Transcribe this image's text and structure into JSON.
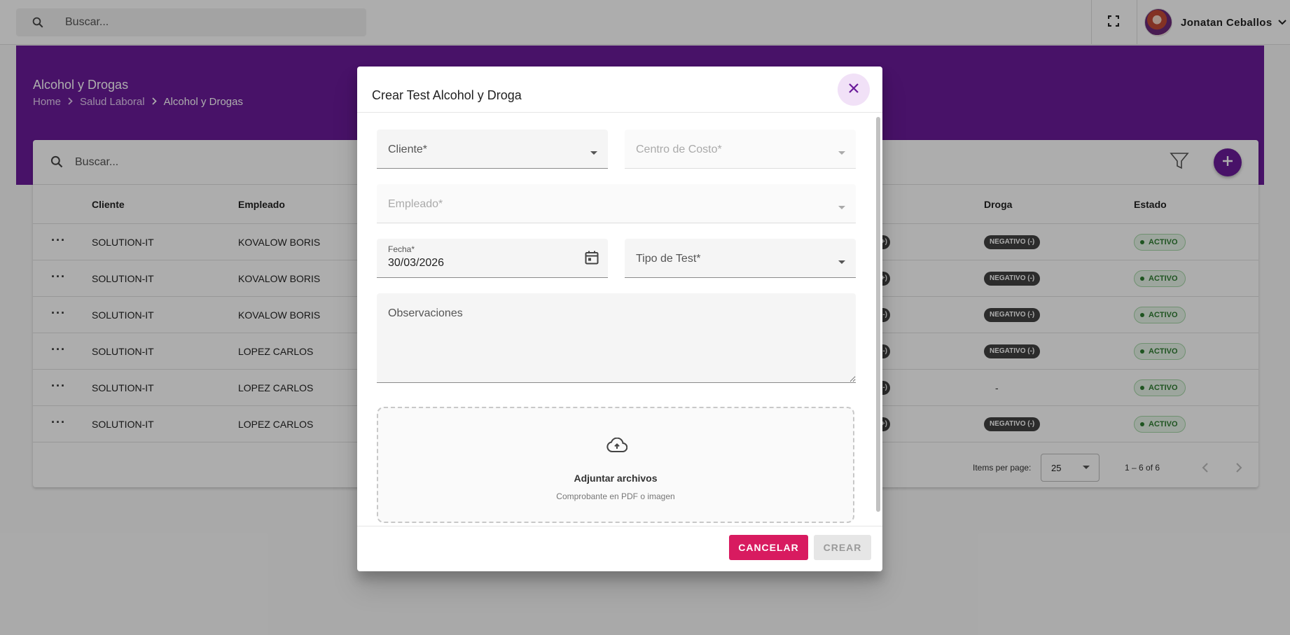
{
  "topbar": {
    "search_placeholder": "Buscar...",
    "user_name": "Jonatan Ceballos"
  },
  "header": {
    "title": "Alcohol y Drogas",
    "breadcrumb": [
      "Home",
      "Salud Laboral",
      "Alcohol y Drogas"
    ]
  },
  "table": {
    "search_placeholder": "Buscar...",
    "columns": [
      "Cliente",
      "Empleado",
      "Droga",
      "Estado"
    ],
    "rows": [
      {
        "cliente": "SOLUTION-IT",
        "empleado": "KOVALOW BORIS",
        "alcohol_chip": "+)",
        "droga": "NEGATIVO (-)",
        "estado": "ACTIVO"
      },
      {
        "cliente": "SOLUTION-IT",
        "empleado": "KOVALOW BORIS",
        "alcohol_chip": "+)",
        "droga": "NEGATIVO (-)",
        "estado": "ACTIVO"
      },
      {
        "cliente": "SOLUTION-IT",
        "empleado": "KOVALOW BORIS",
        "alcohol_chip": "-)",
        "droga": "NEGATIVO (-)",
        "estado": "ACTIVO"
      },
      {
        "cliente": "SOLUTION-IT",
        "empleado": "LOPEZ CARLOS",
        "alcohol_chip": "-)",
        "droga": "NEGATIVO (-)",
        "estado": "ACTIVO"
      },
      {
        "cliente": "SOLUTION-IT",
        "empleado": "LOPEZ CARLOS",
        "alcohol_chip": "-)",
        "droga": "-",
        "estado": "ACTIVO"
      },
      {
        "cliente": "SOLUTION-IT",
        "empleado": "LOPEZ CARLOS",
        "alcohol_chip": "+)",
        "droga": "NEGATIVO (-)",
        "estado": "ACTIVO"
      }
    ],
    "paginator": {
      "items_per_page_label": "Items per page:",
      "page_size": "25",
      "range": "1 – 6 of 6"
    }
  },
  "dialog": {
    "title": "Crear Test Alcohol y Droga",
    "fields": {
      "cliente_label": "Cliente*",
      "centro_costo_label": "Centro de Costo*",
      "empleado_label": "Empleado*",
      "fecha_label": "Fecha*",
      "fecha_value": "30/03/2026",
      "tipo_test_label": "Tipo de Test*",
      "observaciones_placeholder": "Observaciones"
    },
    "dropzone": {
      "title": "Adjuntar archivos",
      "subtitle": "Comprobante en PDF o imagen"
    },
    "buttons": {
      "cancel": "CANCELAR",
      "create": "CREAR"
    }
  },
  "colors": {
    "primary": "#6a1b9a",
    "accent": "#d81b60",
    "success": "#2e7d32"
  }
}
